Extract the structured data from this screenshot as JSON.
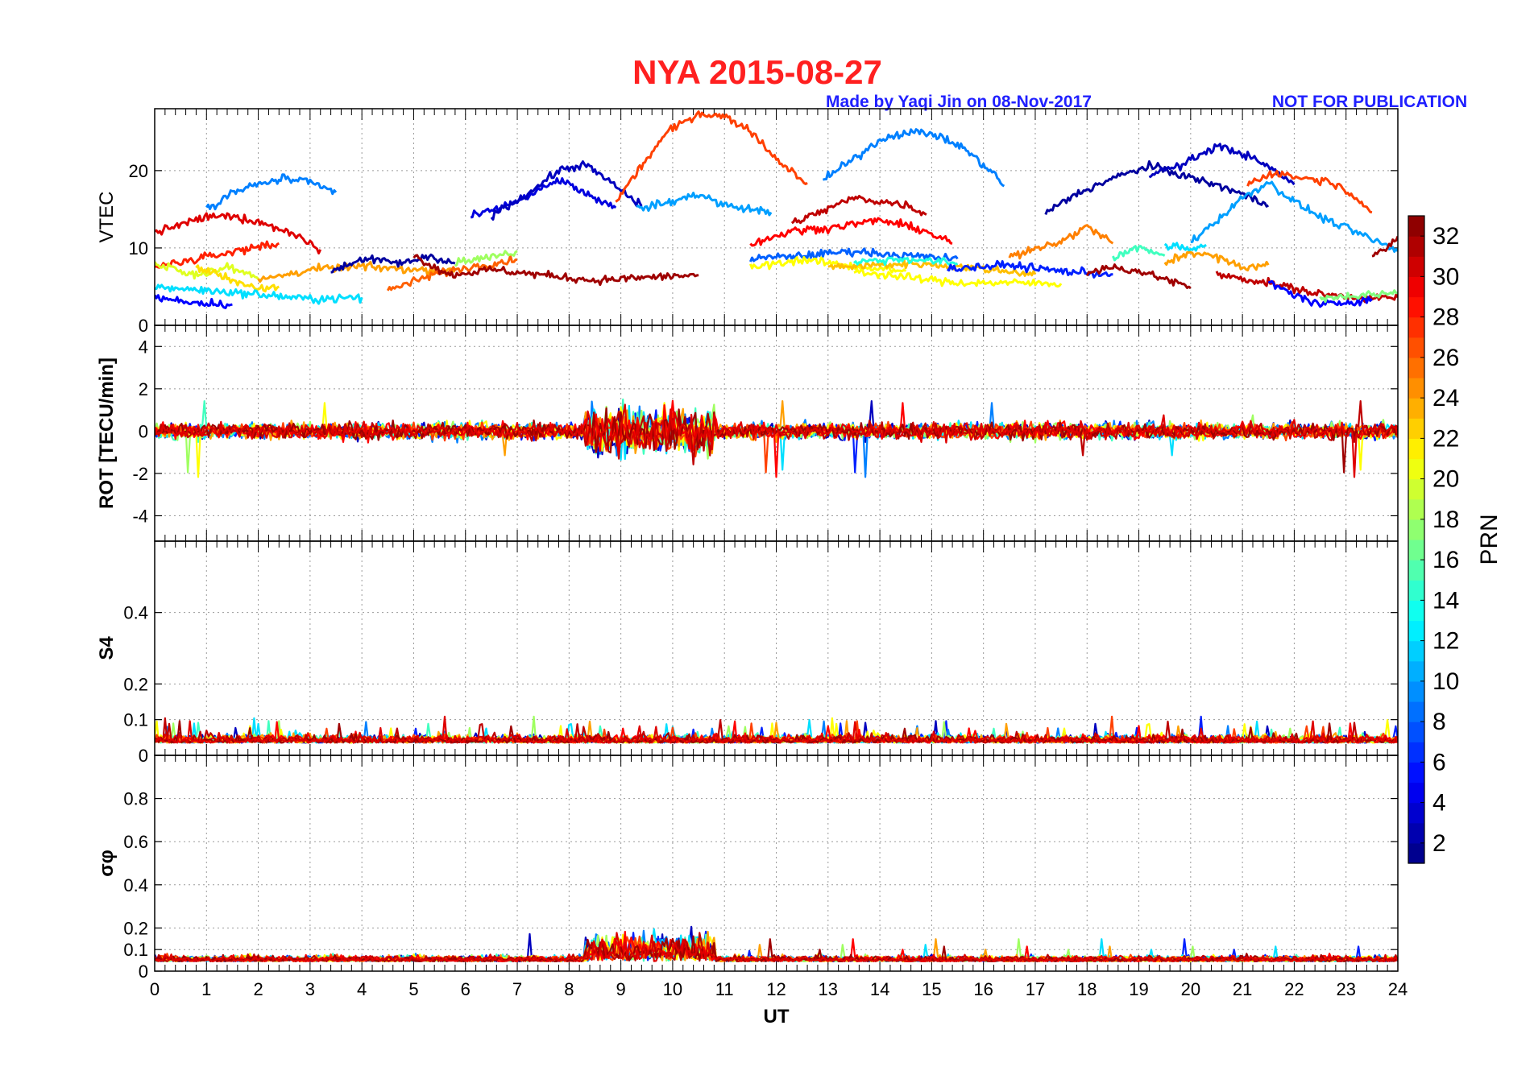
{
  "header": {
    "title": "NYA   2015-08-27",
    "credit": "Made by Yaqi Jin on 08-Nov-2017",
    "notice": "NOT FOR PUBLICATION",
    "title_color": "#ff2020",
    "credit_color": "#2020ff"
  },
  "chart_data": {
    "type": "line",
    "x": {
      "label": "UT",
      "range": [
        0,
        24
      ],
      "ticks": [
        0,
        1,
        2,
        3,
        4,
        5,
        6,
        7,
        8,
        9,
        10,
        11,
        12,
        13,
        14,
        15,
        16,
        17,
        18,
        19,
        20,
        21,
        22,
        23,
        24
      ]
    },
    "grid": true,
    "panels": [
      {
        "key": "vtec",
        "ylabel": "VTEC",
        "ylim": [
          0,
          28
        ],
        "ticks": [
          0,
          10,
          20
        ],
        "tick_labels": [
          "0",
          "10",
          "20"
        ]
      },
      {
        "key": "rot",
        "ylabel": "ROT [TECU/min]",
        "ylim": [
          -5.2,
          5
        ],
        "ticks": [
          -4,
          -2,
          0,
          2,
          4
        ],
        "tick_labels": [
          "-4",
          "-2",
          "0",
          "2",
          "4"
        ]
      },
      {
        "key": "s4",
        "ylabel": "S4",
        "ylim": [
          0,
          0.6
        ],
        "ticks": [
          0,
          0.1,
          0.2,
          0.4
        ],
        "tick_labels": [
          "0",
          "0.1",
          "0.2",
          "0.4"
        ]
      },
      {
        "key": "sigma",
        "ylabel": "σφ",
        "ylim": [
          0,
          1.0
        ],
        "ticks": [
          0,
          0.1,
          0.2,
          0.4,
          0.6,
          0.8
        ],
        "tick_labels": [
          "0",
          "0.1",
          "0.2",
          "0.4",
          "0.6",
          "0.8"
        ]
      }
    ],
    "colorbar": {
      "label": "PRN",
      "range": [
        1,
        33
      ],
      "ticks": [
        2,
        4,
        6,
        8,
        10,
        12,
        14,
        16,
        18,
        20,
        22,
        24,
        26,
        28,
        30,
        32
      ]
    },
    "vtec_arcs": [
      {
        "prn": 30,
        "points": [
          [
            0.0,
            12.0
          ],
          [
            0.4,
            12.8
          ],
          [
            1.0,
            14.0
          ],
          [
            1.5,
            14.1
          ],
          [
            2.0,
            13.4
          ],
          [
            2.6,
            12.0
          ],
          [
            3.0,
            10.8
          ],
          [
            3.2,
            9.8
          ]
        ]
      },
      {
        "prn": 9,
        "points": [
          [
            1.0,
            15.0
          ],
          [
            1.5,
            17.2
          ],
          [
            2.0,
            18.2
          ],
          [
            2.5,
            19.0
          ],
          [
            3.0,
            18.4
          ],
          [
            3.5,
            17.2
          ]
        ]
      },
      {
        "prn": 28,
        "points": [
          [
            0.0,
            7.5
          ],
          [
            1.0,
            8.8
          ],
          [
            2.0,
            10.2
          ],
          [
            2.4,
            10.6
          ]
        ]
      },
      {
        "prn": 20,
        "points": [
          [
            0.0,
            8.0
          ],
          [
            0.7,
            6.5
          ],
          [
            1.5,
            7.5
          ],
          [
            2.0,
            6.0
          ]
        ]
      },
      {
        "prn": 22,
        "points": [
          [
            0.8,
            7.5
          ],
          [
            1.4,
            6.2
          ],
          [
            2.0,
            4.5
          ],
          [
            2.4,
            5.0
          ]
        ]
      },
      {
        "prn": 12,
        "points": [
          [
            0.0,
            5.0
          ],
          [
            1.0,
            4.5
          ],
          [
            2.0,
            4.0
          ],
          [
            3.0,
            3.4
          ],
          [
            4.0,
            3.6
          ]
        ]
      },
      {
        "prn": 5,
        "points": [
          [
            0.0,
            3.6
          ],
          [
            0.7,
            3.0
          ],
          [
            1.5,
            2.7
          ]
        ]
      },
      {
        "prn": 24,
        "points": [
          [
            2.0,
            5.8
          ],
          [
            3.0,
            7.2
          ],
          [
            4.0,
            7.6
          ],
          [
            5.0,
            7.2
          ],
          [
            5.8,
            7.0
          ]
        ]
      },
      {
        "prn": 2,
        "points": [
          [
            3.4,
            7.0
          ],
          [
            4.0,
            8.6
          ],
          [
            4.8,
            8.0
          ],
          [
            5.3,
            9.0
          ],
          [
            5.8,
            8.0
          ]
        ]
      },
      {
        "prn": 26,
        "points": [
          [
            4.5,
            4.5
          ],
          [
            5.5,
            6.8
          ],
          [
            6.5,
            8.0
          ],
          [
            7.0,
            8.5
          ]
        ]
      },
      {
        "prn": 18,
        "points": [
          [
            5.8,
            8.2
          ],
          [
            6.5,
            8.8
          ],
          [
            7.0,
            9.6
          ]
        ]
      },
      {
        "prn": 32,
        "points": [
          [
            5.0,
            9.0
          ],
          [
            5.7,
            6.5
          ],
          [
            6.5,
            7.2
          ],
          [
            7.5,
            6.5
          ],
          [
            8.5,
            5.8
          ],
          [
            9.5,
            6.2
          ],
          [
            10.5,
            6.5
          ]
        ]
      },
      {
        "prn": 4,
        "points": [
          [
            6.1,
            14.0
          ],
          [
            6.6,
            15.0
          ],
          [
            7.2,
            16.6
          ],
          [
            7.8,
            18.8
          ],
          [
            8.2,
            17.5
          ],
          [
            8.5,
            16.2
          ],
          [
            8.9,
            15.2
          ]
        ]
      },
      {
        "prn": 3,
        "points": [
          [
            6.5,
            14.2
          ],
          [
            7.2,
            17.0
          ],
          [
            7.8,
            20.0
          ],
          [
            8.3,
            20.8
          ],
          [
            8.8,
            18.5
          ],
          [
            9.4,
            15.4
          ]
        ]
      },
      {
        "prn": 27,
        "points": [
          [
            8.9,
            16.0
          ],
          [
            9.4,
            20.6
          ],
          [
            9.9,
            25.0
          ],
          [
            10.5,
            27.4
          ],
          [
            11.0,
            27.0
          ],
          [
            11.5,
            25.2
          ],
          [
            12.0,
            21.5
          ],
          [
            12.6,
            18.4
          ]
        ]
      },
      {
        "prn": 10,
        "points": [
          [
            9.3,
            15.0
          ],
          [
            10.0,
            16.0
          ],
          [
            10.5,
            17.0
          ],
          [
            11.0,
            15.5
          ],
          [
            11.5,
            15.0
          ],
          [
            11.9,
            14.6
          ]
        ]
      },
      {
        "prn": 8,
        "points": [
          [
            11.5,
            8.6
          ],
          [
            12.5,
            9.0
          ],
          [
            13.5,
            9.6
          ],
          [
            14.5,
            9.0
          ],
          [
            15.5,
            8.6
          ]
        ]
      },
      {
        "prn": 21,
        "points": [
          [
            11.5,
            7.5
          ],
          [
            12.5,
            8.5
          ],
          [
            13.5,
            7.6
          ],
          [
            14.5,
            7.0
          ]
        ]
      },
      {
        "prn": 31,
        "points": [
          [
            12.3,
            13.2
          ],
          [
            12.8,
            14.5
          ],
          [
            13.5,
            16.5
          ],
          [
            14.0,
            16.0
          ],
          [
            14.5,
            15.6
          ],
          [
            14.9,
            14.3
          ]
        ]
      },
      {
        "prn": 29,
        "points": [
          [
            11.5,
            10.5
          ],
          [
            12.3,
            12.2
          ],
          [
            13.0,
            12.6
          ],
          [
            14.0,
            13.6
          ],
          [
            14.8,
            12.4
          ],
          [
            15.4,
            10.6
          ]
        ]
      },
      {
        "prn": 9,
        "points": [
          [
            12.9,
            18.8
          ],
          [
            13.5,
            21.5
          ],
          [
            14.0,
            24.0
          ],
          [
            14.5,
            25.0
          ],
          [
            15.0,
            24.8
          ],
          [
            15.6,
            23.0
          ],
          [
            16.2,
            19.6
          ],
          [
            16.4,
            18.0
          ]
        ]
      },
      {
        "prn": 23,
        "points": [
          [
            13.0,
            7.5
          ],
          [
            14.0,
            7.8
          ],
          [
            14.7,
            8.0
          ],
          [
            15.5,
            7.6
          ],
          [
            16.5,
            7.0
          ],
          [
            17.0,
            6.6
          ]
        ]
      },
      {
        "prn": 14,
        "points": [
          [
            13.5,
            8.2
          ],
          [
            14.5,
            8.6
          ],
          [
            15.5,
            8.0
          ]
        ]
      },
      {
        "prn": 21,
        "points": [
          [
            13.5,
            7.0
          ],
          [
            14.5,
            6.2
          ],
          [
            15.5,
            5.5
          ],
          [
            16.5,
            5.5
          ],
          [
            17.5,
            5.4
          ]
        ]
      },
      {
        "prn": 6,
        "points": [
          [
            15.3,
            7.3
          ],
          [
            16.5,
            7.8
          ],
          [
            17.5,
            7.0
          ],
          [
            18.5,
            6.6
          ]
        ]
      },
      {
        "prn": 25,
        "points": [
          [
            16.5,
            8.8
          ],
          [
            17.5,
            10.8
          ],
          [
            18.0,
            12.8
          ],
          [
            18.5,
            10.6
          ]
        ]
      },
      {
        "prn": 2,
        "points": [
          [
            17.2,
            14.5
          ],
          [
            17.8,
            17.0
          ],
          [
            18.5,
            19.0
          ],
          [
            19.2,
            20.6
          ],
          [
            19.8,
            19.5
          ],
          [
            20.8,
            17.5
          ],
          [
            21.5,
            15.5
          ]
        ]
      },
      {
        "prn": 3,
        "points": [
          [
            19.2,
            19.6
          ],
          [
            19.8,
            20.6
          ],
          [
            20.5,
            23.2
          ],
          [
            21.0,
            22.2
          ],
          [
            21.5,
            20.5
          ],
          [
            22.0,
            18.2
          ]
        ]
      },
      {
        "prn": 10,
        "points": [
          [
            20.0,
            10.8
          ],
          [
            20.5,
            13.5
          ],
          [
            21.0,
            16.5
          ],
          [
            21.5,
            18.5
          ],
          [
            22.0,
            16.0
          ],
          [
            22.5,
            14.0
          ],
          [
            23.2,
            12.0
          ],
          [
            24.0,
            9.6
          ]
        ]
      },
      {
        "prn": 27,
        "points": [
          [
            21.1,
            18.2
          ],
          [
            21.6,
            19.8
          ],
          [
            22.0,
            19.2
          ],
          [
            22.7,
            18.6
          ],
          [
            23.2,
            16.6
          ],
          [
            23.5,
            14.6
          ]
        ]
      },
      {
        "prn": 12,
        "points": [
          [
            19.5,
            10.2
          ],
          [
            20.0,
            9.8
          ],
          [
            20.3,
            10.4
          ]
        ]
      },
      {
        "prn": 15,
        "points": [
          [
            18.5,
            8.6
          ],
          [
            19.0,
            10.2
          ],
          [
            19.5,
            9.0
          ]
        ]
      },
      {
        "prn": 32,
        "points": [
          [
            18.0,
            6.8
          ],
          [
            18.5,
            7.5
          ],
          [
            19.0,
            7.0
          ],
          [
            19.5,
            6.0
          ],
          [
            20.0,
            4.8
          ]
        ]
      },
      {
        "prn": 24,
        "points": [
          [
            19.5,
            8.0
          ],
          [
            20.0,
            9.5
          ],
          [
            20.5,
            8.8
          ],
          [
            21.0,
            7.5
          ],
          [
            21.5,
            7.8
          ]
        ]
      },
      {
        "prn": 31,
        "points": [
          [
            20.5,
            6.6
          ],
          [
            21.5,
            5.5
          ],
          [
            22.5,
            4.0
          ],
          [
            23.5,
            3.5
          ],
          [
            24.0,
            3.6
          ]
        ]
      },
      {
        "prn": 5,
        "points": [
          [
            21.5,
            5.5
          ],
          [
            22.0,
            4.0
          ],
          [
            22.5,
            2.6
          ],
          [
            23.0,
            3.0
          ],
          [
            23.5,
            3.4
          ]
        ]
      },
      {
        "prn": 32,
        "points": [
          [
            23.5,
            9.0
          ],
          [
            23.8,
            10.0
          ],
          [
            24.0,
            11.5
          ]
        ]
      },
      {
        "prn": 17,
        "points": [
          [
            22.5,
            3.5
          ],
          [
            23.5,
            4.0
          ],
          [
            24.0,
            4.2
          ]
        ]
      }
    ]
  }
}
